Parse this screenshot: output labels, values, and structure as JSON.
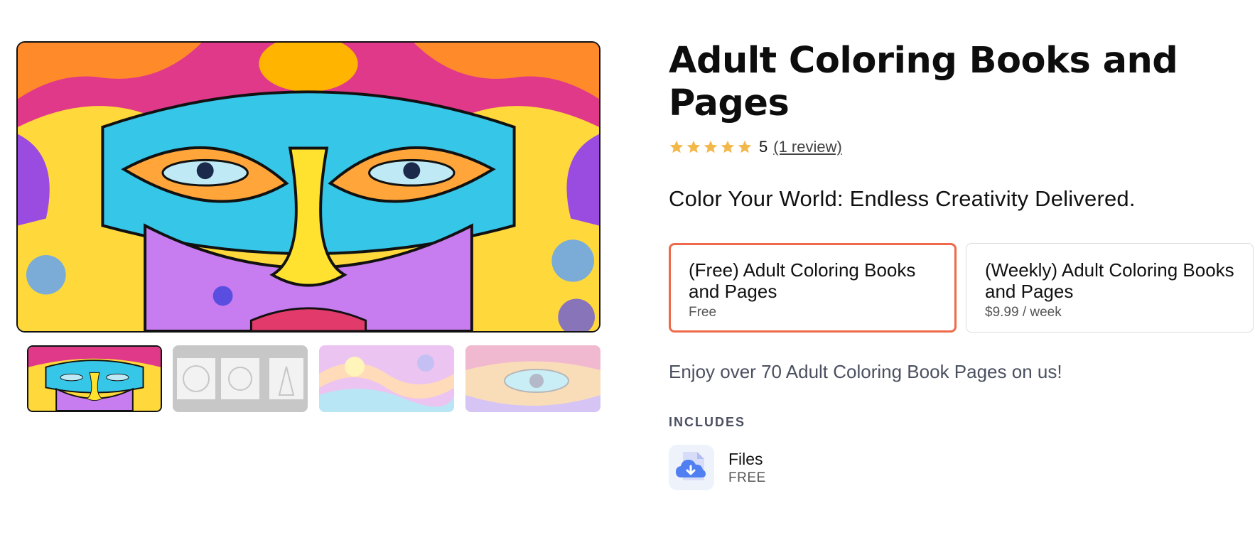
{
  "product": {
    "title": "Adult Coloring Books and Pages",
    "rating": {
      "score": "5",
      "stars": 5,
      "reviews_link": "(1 review)"
    },
    "tagline": "Color Your World: Endless Creativity Delivered.",
    "description": "Enjoy over 70 Adult Coloring Book Pages on us!"
  },
  "options": [
    {
      "title": "(Free) Adult Coloring Books and Pages",
      "price": "Free",
      "selected": true
    },
    {
      "title": "(Weekly) Adult Coloring Books and Pages",
      "price": "$9.99 / week",
      "selected": false
    }
  ],
  "includes": {
    "label": "INCLUDES",
    "items": [
      {
        "name": "Files",
        "price": "FREE",
        "icon": "cloud-download-file-icon"
      }
    ]
  },
  "gallery": {
    "thumbnail_count": 4,
    "active_index": 0
  },
  "colors": {
    "accent": "#ee6a4a",
    "star": "#f2b84b",
    "muted_text": "#4a5060"
  }
}
